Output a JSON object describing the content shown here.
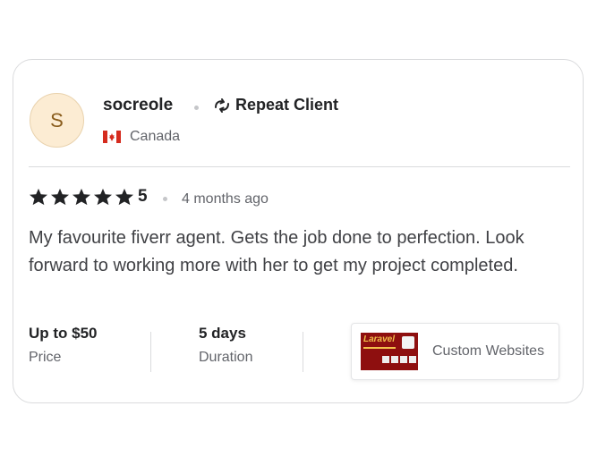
{
  "reviewer": {
    "avatar_initial": "S",
    "username": "socreole",
    "badge": "Repeat Client",
    "country": "Canada"
  },
  "rating": {
    "stars": 5,
    "value": "5",
    "time_ago": "4 months ago"
  },
  "review_text": "My favourite fiverr agent. Gets the job done to perfection. Look forward to working more with her to get my project completed.",
  "details": {
    "price_value": "Up to $50",
    "price_label": "Price",
    "duration_value": "5 days",
    "duration_label": "Duration"
  },
  "gig": {
    "thumbnail_text": "Laravel",
    "title": "Custom Websites"
  },
  "colors": {
    "star": "#222325",
    "flag_red": "#d52b1e",
    "avatar_bg": "#fcecd3"
  },
  "icons": [
    "repeat-client-icon",
    "canada-flag-icon",
    "star-icon"
  ]
}
